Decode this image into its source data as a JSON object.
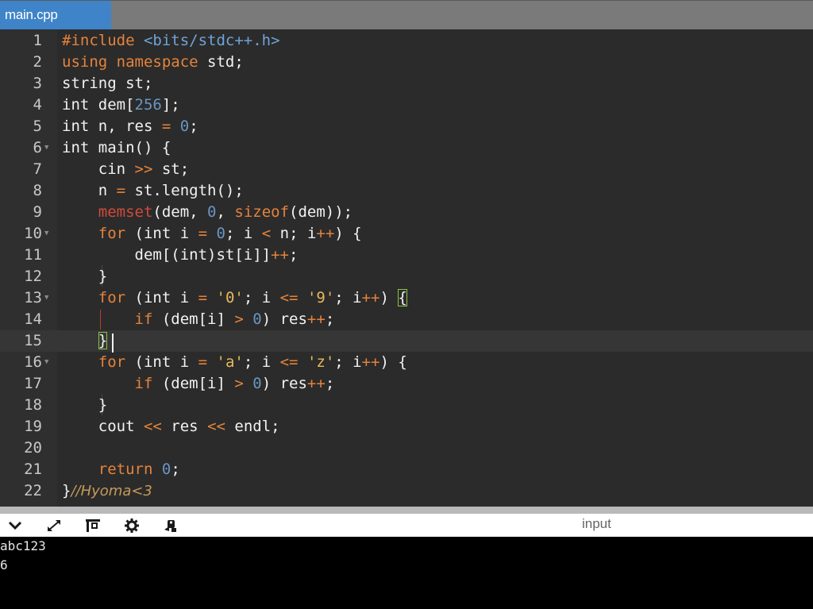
{
  "tab": {
    "label": "main.cpp"
  },
  "editor": {
    "lines": [
      {
        "n": "1"
      },
      {
        "n": "2"
      },
      {
        "n": "3"
      },
      {
        "n": "4"
      },
      {
        "n": "5"
      },
      {
        "n": "6"
      },
      {
        "n": "7"
      },
      {
        "n": "8"
      },
      {
        "n": "9"
      },
      {
        "n": "10"
      },
      {
        "n": "11"
      },
      {
        "n": "12"
      },
      {
        "n": "13"
      },
      {
        "n": "14"
      },
      {
        "n": "15"
      },
      {
        "n": "16"
      },
      {
        "n": "17"
      },
      {
        "n": "18"
      },
      {
        "n": "19"
      },
      {
        "n": "20"
      },
      {
        "n": "21"
      },
      {
        "n": "22"
      }
    ],
    "code": {
      "l1": {
        "kw": "#include",
        "inc": "<bits/stdc++.h>"
      },
      "l2": {
        "kw": "using namespace",
        "rest": "std;"
      },
      "l3": {
        "text": "string st;"
      },
      "l4": {
        "a": "int dem[",
        "num": "256",
        "b": "];"
      },
      "l5": {
        "a": "int n, res ",
        "op": "=",
        "num": "0",
        "b": ";"
      },
      "l6": {
        "text": "int main() {"
      },
      "l7": {
        "a": "    cin ",
        "op": ">>",
        "b": " st;"
      },
      "l8": {
        "a": "    n ",
        "op": "=",
        "b": " st.length();"
      },
      "l9": {
        "fn": "memset",
        "a": "(dem, ",
        "num": "0",
        "b": ", ",
        "fn2": "sizeof",
        "c": "(dem));"
      },
      "l10": {
        "kw": "for",
        "a": " (int i ",
        "op": "=",
        "sp": " ",
        "num": "0",
        "b": "; i ",
        "op2": "<",
        "c": " n; i",
        "op3": "++",
        "d": ") {"
      },
      "l11": {
        "a": "dem[(int)st[i]]",
        "op": "++",
        "b": ";"
      },
      "l12": {
        "text": "}"
      },
      "l13": {
        "kw": "for",
        "a": " (int i ",
        "op": "=",
        "sp": " ",
        "str": "'0'",
        "b": "; i ",
        "op2": "<=",
        "sp2": " ",
        "str2": "'9'",
        "c": "; i",
        "op3": "++",
        "d": ") ",
        "br": "{"
      },
      "l14": {
        "kw": "if",
        "a": " (dem[i] ",
        "op": ">",
        "sp": " ",
        "num": "0",
        "b": ") res",
        "op2": "++",
        "c": ";"
      },
      "l15": {
        "br": "}"
      },
      "l16": {
        "kw": "for",
        "a": " (int i ",
        "op": "=",
        "sp": " ",
        "str": "'a'",
        "b": "; i ",
        "op2": "<=",
        "sp2": " ",
        "str2": "'z'",
        "c": "; i",
        "op3": "++",
        "d": ") {"
      },
      "l17": {
        "kw": "if",
        "a": " (dem[i] ",
        "op": ">",
        "sp": " ",
        "num": "0",
        "b": ") res",
        "op2": "++",
        "c": ";"
      },
      "l18": {
        "text": "}"
      },
      "l19": {
        "a": "cout ",
        "op": "<<",
        "b": " res ",
        "op2": "<<",
        "c": " endl;"
      },
      "l20": {
        "text": ""
      },
      "l21": {
        "kw": "return",
        "sp": " ",
        "num": "0",
        "b": ";"
      },
      "l22": {
        "a": "}",
        "cm": "//Hyoma<3"
      }
    }
  },
  "toolbar": {
    "icons": [
      "chevron-down-icon",
      "expand-icon",
      "layout-icon",
      "gear-icon",
      "debug-icon"
    ],
    "label": "input"
  },
  "output": {
    "lines": [
      "abc123",
      "6"
    ]
  },
  "colors": {
    "tab_bg": "#3f84c9",
    "editor_bg": "#2b2b2b",
    "keyword": "#e5833b",
    "number": "#6896c2",
    "string": "#e8b95a",
    "function": "#d04a3a",
    "bracket_match": "#8ac543"
  }
}
